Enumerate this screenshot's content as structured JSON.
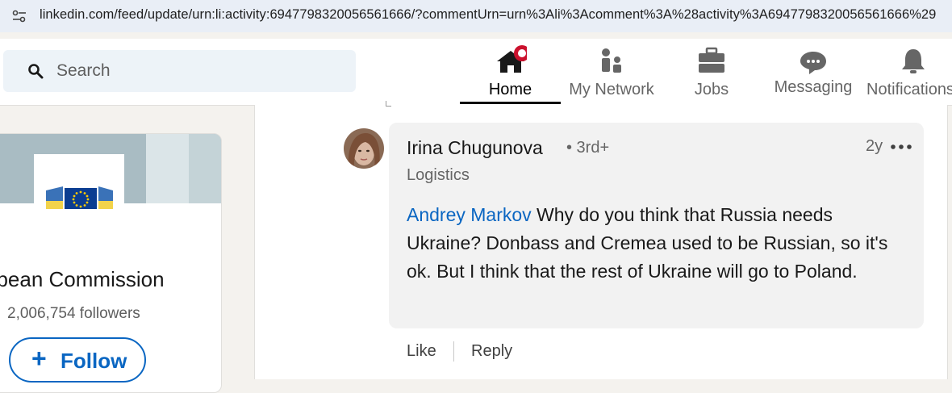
{
  "browser": {
    "url": "linkedin.com/feed/update/urn:li:activity:6947798320056561666/?commentUrn=urn%3Ali%3Acomment%3A%28activity%3A6947798320056561666%29"
  },
  "nav": {
    "search_placeholder": "Search",
    "items": [
      {
        "label": "Home",
        "icon": "home-icon",
        "active": true
      },
      {
        "label": "My Network",
        "icon": "network-icon"
      },
      {
        "label": "Jobs",
        "icon": "briefcase-icon"
      },
      {
        "label": "Messaging",
        "icon": "message-icon"
      },
      {
        "label": "Notifications",
        "icon": "bell-icon"
      }
    ],
    "accent": "#0a66c2",
    "badge_color": "#cb112d"
  },
  "org_card": {
    "name": "opean Commission",
    "followers": "2,006,754 followers",
    "follow_plus": "+",
    "follow_label": "Follow"
  },
  "comment": {
    "author": "Irina Chugunova",
    "degree": "• 3rd+",
    "headline": "Logistics",
    "time": "2y",
    "mention": "Andrey Markov",
    "body": " Why do you think that Russia needs Ukraine? Donbass and Cremea used to be Russian, so it's ok. But I think that the rest of Ukraine will go to Poland.",
    "like": "Like",
    "reply": "Reply"
  }
}
